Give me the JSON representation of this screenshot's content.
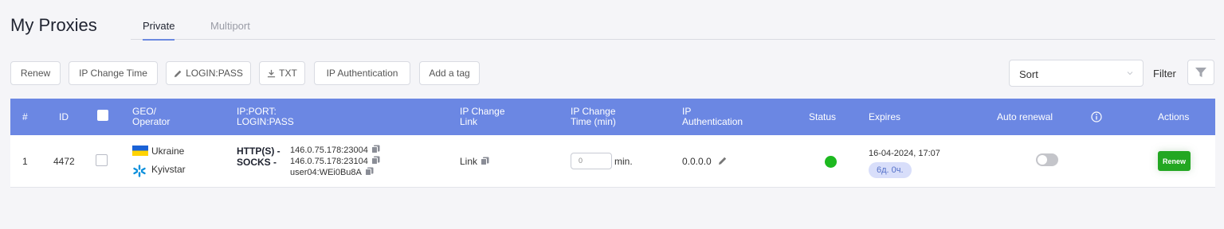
{
  "page": {
    "title": "My Proxies"
  },
  "tabs": [
    {
      "label": "Private",
      "active": true
    },
    {
      "label": "Multiport",
      "active": false
    }
  ],
  "toolbar": {
    "buttons": [
      {
        "label": "Renew"
      },
      {
        "label": "IP Change Time"
      },
      {
        "label": "LOGIN:PASS",
        "icon": "pencil-icon"
      },
      {
        "label": "TXT",
        "icon": "download-icon"
      },
      {
        "label": "IP Authentication"
      },
      {
        "label": "Add a tag"
      }
    ],
    "sort_value": "Sort",
    "filter_label": "Filter"
  },
  "table": {
    "headers": {
      "num": "#",
      "id": "ID",
      "geo": [
        "GEO/",
        "Operator"
      ],
      "ipport": [
        "IP:PORT:",
        "LOGIN:PASS"
      ],
      "change_link": [
        "IP Change",
        "Link"
      ],
      "change_time": [
        "IP Change",
        "Time (min)"
      ],
      "auth": [
        "IP",
        "Authentication"
      ],
      "status": "Status",
      "expires": "Expires",
      "auto_renewal": "Auto renewal",
      "info_icon": "info-icon",
      "actions": "Actions"
    },
    "rows": [
      {
        "num": "1",
        "id": "4472",
        "country": "Ukraine",
        "operator": "Kyivstar",
        "http_label": "HTTP(S) -",
        "socks_label": "SOCKS -",
        "http_addr": "146.0.75.178:23004",
        "socks_addr": "146.0.75.178:23104",
        "credentials": "user04:WEi0Bu8A",
        "link": "Link",
        "change_time_value": "0",
        "change_time_unit": "min.",
        "auth": "0.0.0.0",
        "status": "active",
        "status_color": "#1db920",
        "expires": "16-04-2024, 17:07",
        "remaining": "6д. 0ч.",
        "auto_renewal": false,
        "action": "Renew"
      }
    ]
  },
  "colors": {
    "header_bg": "#6b87e3",
    "accent": "#6c8ae0",
    "renew": "#23a722"
  }
}
